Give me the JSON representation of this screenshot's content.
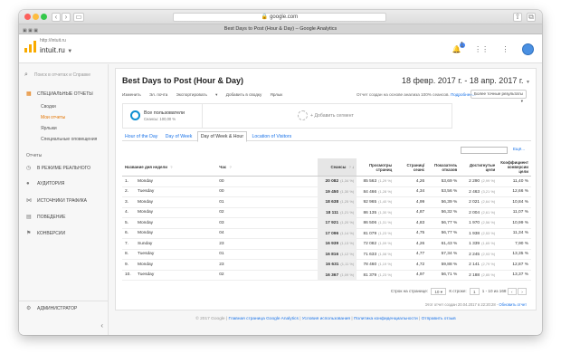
{
  "browser": {
    "address": "google.com",
    "tab_title": "Best Days to Post (Hour & Day) – Google Analytics",
    "nav_back": "‹",
    "nav_forward": "›"
  },
  "header": {
    "account_sub": "http://intuit.ru",
    "account_name": "intuit.ru",
    "notif_count": "1"
  },
  "sidebar": {
    "search_placeholder": "Поиск в отчетах и Справке",
    "special": "Специальные отчеты",
    "subitems": [
      "Сводки",
      "Мои отчеты",
      "Ярлыки",
      "Специальные оповещения"
    ],
    "reports_label": "Отчеты",
    "items": [
      "В режиме реального",
      "Аудитория",
      "Источники трафика",
      "Поведение",
      "Конверсии"
    ],
    "admin": "Администратор"
  },
  "report": {
    "title": "Best Days to Post (Hour & Day)",
    "daterange": "18 февр. 2017 г. - 18 апр. 2017 г.",
    "toolbar": [
      "Изменить",
      "Эл. почта",
      "Экспортировать",
      "Добавить в сводку",
      "Ярлык"
    ],
    "sample_text": "Отчет создан на основе анализа 100% сеансов.",
    "sample_link": "Подробнее...",
    "precision": "Более точные результаты",
    "segment_name": "Все пользователи",
    "segment_pct": "Сеансы: 100,00 %",
    "add_segment": "+ Добавить сегмент",
    "tabs": [
      "Hour of the Day",
      "Day of Week",
      "Day of Week & Hour",
      "Location of Visitors"
    ],
    "search_link": "Ещё...",
    "columns": [
      "Название дня недели",
      "Час",
      "Сеансы",
      "Просмотры страниц",
      "Страниц/сеанс",
      "Показатель отказов",
      "Достигнутые цели",
      "Коэффициент конверсии цели"
    ],
    "rows": [
      {
        "n": "1.",
        "day": "Monday",
        "hour": "00",
        "sessions": "20 082",
        "s_pct": "(1,34 %)",
        "views": "85 563",
        "v_pct": "(1,29 %)",
        "pps": "4,26",
        "bounce": "53,69 %",
        "goals": "2 290",
        "g_pct": "(2,99 %)",
        "conv": "11,40 %"
      },
      {
        "n": "2.",
        "day": "Tuesday",
        "hour": "00",
        "sessions": "19 450",
        "s_pct": "(1,30 %)",
        "views": "84 466",
        "v_pct": "(1,28 %)",
        "pps": "4,34",
        "bounce": "53,56 %",
        "goals": "2 463",
        "g_pct": "(3,21 %)",
        "conv": "12,66 %"
      },
      {
        "n": "3.",
        "day": "Monday",
        "hour": "01",
        "sessions": "18 638",
        "s_pct": "(1,25 %)",
        "views": "92 965",
        "v_pct": "(1,40 %)",
        "pps": "4,99",
        "bounce": "56,39 %",
        "goals": "2 021",
        "g_pct": "(2,64 %)",
        "conv": "10,84 %"
      },
      {
        "n": "4.",
        "day": "Monday",
        "hour": "02",
        "sessions": "18 111",
        "s_pct": "(1,21 %)",
        "views": "86 135",
        "v_pct": "(1,30 %)",
        "pps": "4,87",
        "bounce": "56,32 %",
        "goals": "2 004",
        "g_pct": "(2,61 %)",
        "conv": "11,07 %"
      },
      {
        "n": "5.",
        "day": "Monday",
        "hour": "03",
        "sessions": "17 921",
        "s_pct": "(1,20 %)",
        "views": "86 506",
        "v_pct": "(1,31 %)",
        "pps": "4,83",
        "bounce": "56,77 %",
        "goals": "1 970",
        "g_pct": "(2,56 %)",
        "conv": "10,99 %"
      },
      {
        "n": "6.",
        "day": "Monday",
        "hour": "04",
        "sessions": "17 096",
        "s_pct": "(1,14 %)",
        "views": "81 079",
        "v_pct": "(1,23 %)",
        "pps": "4,75",
        "bounce": "56,77 %",
        "goals": "1 938",
        "g_pct": "(2,53 %)",
        "conv": "11,34 %"
      },
      {
        "n": "7.",
        "day": "Sunday",
        "hour": "23",
        "sessions": "16 939",
        "s_pct": "(1,13 %)",
        "views": "72 082",
        "v_pct": "(1,09 %)",
        "pps": "4,26",
        "bounce": "61,43 %",
        "goals": "1 339",
        "g_pct": "(1,65 %)",
        "conv": "7,90 %"
      },
      {
        "n": "8.",
        "day": "Tuesday",
        "hour": "01",
        "sessions": "16 816",
        "s_pct": "(1,12 %)",
        "views": "71 633",
        "v_pct": "(1,08 %)",
        "pps": "4,77",
        "bounce": "57,34 %",
        "goals": "2 245",
        "g_pct": "(2,93 %)",
        "conv": "13,35 %"
      },
      {
        "n": "9.",
        "day": "Monday",
        "hour": "23",
        "sessions": "16 631",
        "s_pct": "(1,11 %)",
        "views": "78 460",
        "v_pct": "(1,19 %)",
        "pps": "4,72",
        "bounce": "59,88 %",
        "goals": "2 141",
        "g_pct": "(2,79 %)",
        "conv": "12,87 %"
      },
      {
        "n": "10.",
        "day": "Tuesday",
        "hour": "02",
        "sessions": "16 367",
        "s_pct": "(1,09 %)",
        "views": "81 379",
        "v_pct": "(1,23 %)",
        "pps": "4,97",
        "bounce": "56,71 %",
        "goals": "2 188",
        "g_pct": "(2,85 %)",
        "conv": "13,37 %"
      }
    ],
    "pager_rows_label": "Строк на странице:",
    "pager_rows": "10",
    "pager_goto": "К строке:",
    "pager_goto_val": "1",
    "pager_range": "1 - 10 из 168",
    "generated": "Этот отчет создан 20.04.2017 в 22:20:28 -",
    "generated_link": "Обновить отчет"
  },
  "footer": {
    "copyright": "© 2017 Google |",
    "links": [
      "Главная страница Google Analytics",
      "Условия использования",
      "Политика конфиденциальности",
      "Отправить отзыв"
    ]
  }
}
